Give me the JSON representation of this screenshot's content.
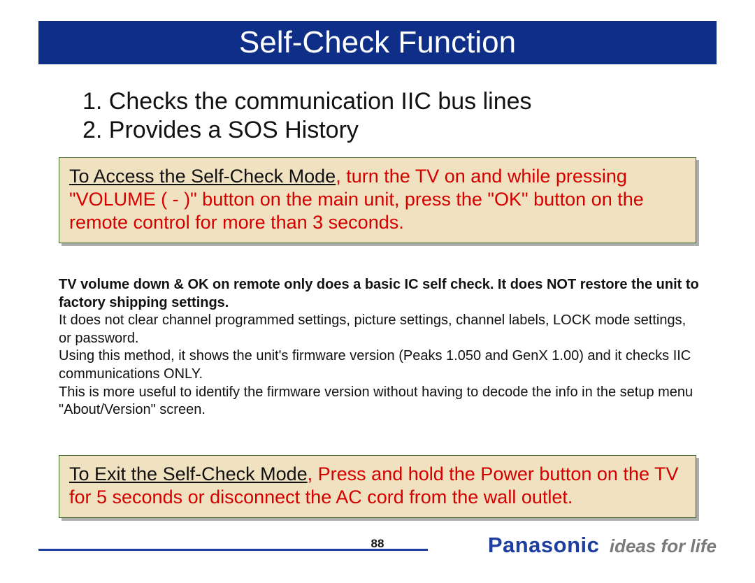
{
  "title": "Self-Check Function",
  "list": {
    "item1": "1. Checks the communication IIC bus lines",
    "item2": "2. Provides a SOS History"
  },
  "box1": {
    "lead": "To Access the Self-Check Mode",
    "rest": ", turn the TV on and while pressing \"VOLUME ( - )\" button on the main unit, press the \"OK\" button on the remote control for more than 3 seconds."
  },
  "middle": {
    "p1": "TV volume down & OK on remote only does a basic IC self check.  It does NOT restore the unit to factory shipping settings.",
    "p2": "It does not clear channel programmed settings,  picture settings, channel labels, LOCK mode settings, or password.",
    "p3": "Using this method, it shows the unit's firmware version (Peaks 1.050  and GenX 1.00)  and it checks IIC communications ONLY.",
    "p4": "This is more useful to identify the firmware version without having to decode the info in the setup menu \"About/Version\" screen."
  },
  "box2": {
    "lead": "To Exit the Self-Check Mode",
    "rest": ", Press and hold the Power button on the TV for 5 seconds or disconnect the AC cord from the wall outlet."
  },
  "page_number": "88",
  "brand": {
    "logo": "Panasonic",
    "tagline": "ideas for life"
  }
}
